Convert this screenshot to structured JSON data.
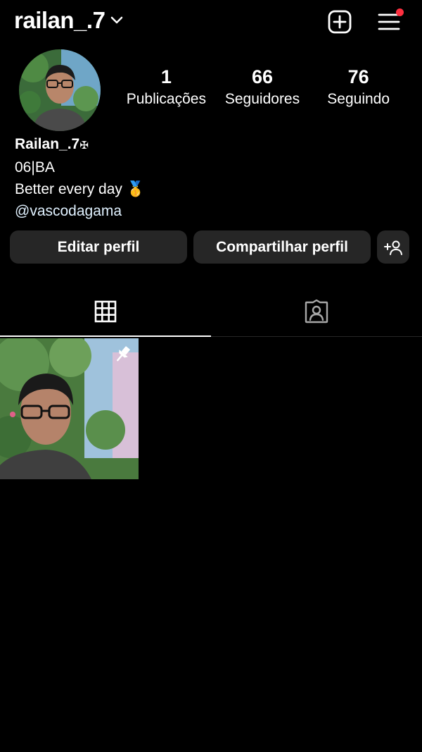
{
  "header": {
    "username": "railan_.7"
  },
  "stats": [
    {
      "value": "1",
      "label": "Publicações"
    },
    {
      "value": "66",
      "label": "Seguidores"
    },
    {
      "value": "76",
      "label": "Seguindo"
    }
  ],
  "bio": {
    "display_name": "Railan_.7",
    "name_symbol": "✠",
    "line1": "06|BA",
    "line2": "Better every day 🥇",
    "link": "@vascodagama"
  },
  "actions": {
    "edit": "Editar perfil",
    "share": "Compartilhar perfil"
  },
  "colors": {
    "background": "#000000",
    "button": "#262626",
    "notification": "#ff3040"
  },
  "icons": {
    "create": "plus-square-icon",
    "menu": "hamburger-menu-icon",
    "add_person": "add-person-icon",
    "grid_tab": "grid-icon",
    "tagged_tab": "tagged-person-icon",
    "pinned": "pin-icon"
  }
}
